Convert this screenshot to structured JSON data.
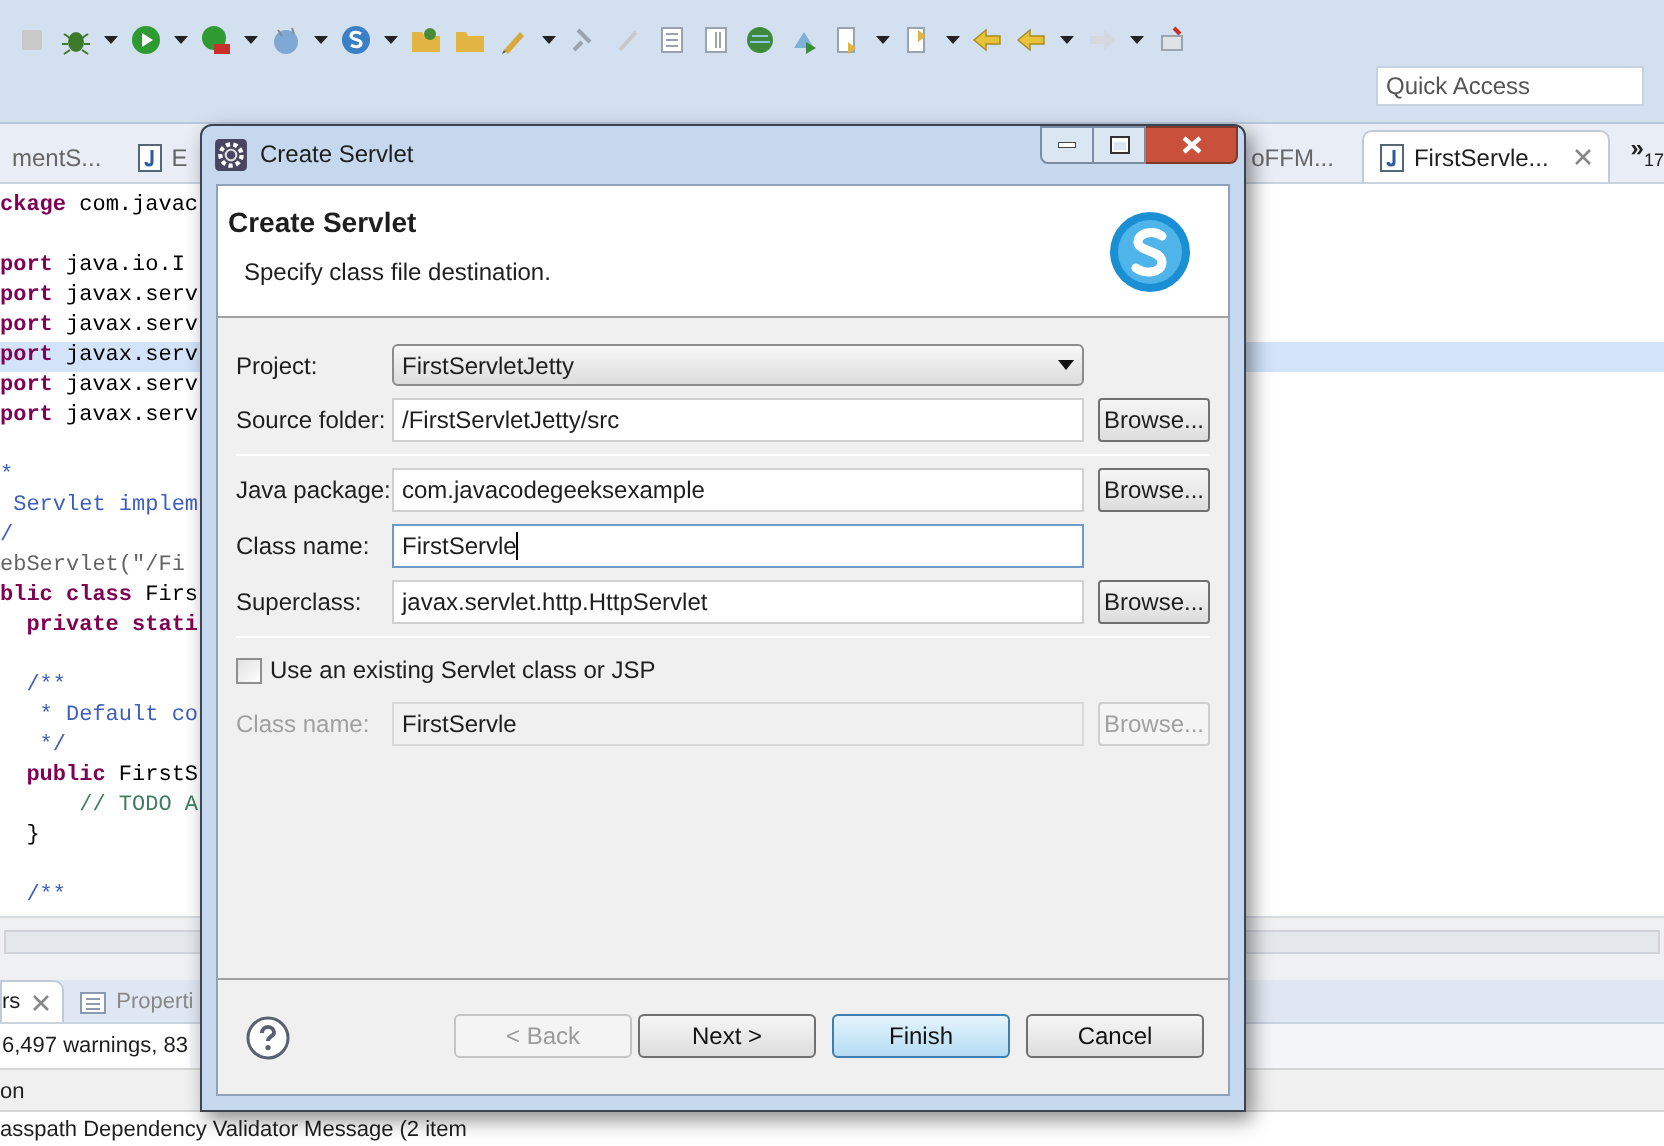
{
  "toolbar": {
    "quick_access": {
      "placeholder": "Quick Access"
    }
  },
  "editor_tabs": [
    {
      "label": "mentS...",
      "selected": false,
      "icon": false
    },
    {
      "label": "E",
      "selected": false,
      "icon": true
    },
    {
      "label": "oFFM...",
      "selected": false,
      "icon": false
    },
    {
      "label": "FirstServle...",
      "selected": true,
      "icon": true
    }
  ],
  "tab_overflow": {
    "symbol": "»",
    "count": "17"
  },
  "code_lines": [
    {
      "text": "**ckage** com.javac",
      "kind": "code",
      "highlighted": false
    },
    {
      "kind": "blank"
    },
    {
      "text": "**port** java.io.I",
      "kind": "code",
      "highlighted": false
    },
    {
      "text": "**port** javax.serv",
      "kind": "code",
      "highlighted": false
    },
    {
      "text": "**port** javax.serv",
      "kind": "code",
      "highlighted": false
    },
    {
      "text": "**port** javax.serv",
      "kind": "code",
      "highlighted": true
    },
    {
      "text": "**port** javax.serv",
      "kind": "code",
      "highlighted": false
    },
    {
      "text": "**port** javax.serv",
      "kind": "code",
      "highlighted": false
    },
    {
      "kind": "blank"
    },
    {
      "text": "*",
      "kind": "comment",
      "highlighted": false
    },
    {
      "text": " Servlet implem",
      "kind": "comment",
      "highlighted": false
    },
    {
      "text": "/",
      "kind": "comment",
      "highlighted": false
    },
    {
      "text": "ebServlet(\"/Fi",
      "kind": "annotation",
      "highlighted": false
    },
    {
      "text": "**blic class** Firs",
      "kind": "code",
      "highlighted": false
    },
    {
      "text": "  **private stati**",
      "kind": "code",
      "highlighted": false
    },
    {
      "kind": "blank"
    },
    {
      "text": "  /**",
      "kind": "comment",
      "highlighted": false
    },
    {
      "text": "   * Default co",
      "kind": "comment",
      "highlighted": false
    },
    {
      "text": "   */",
      "kind": "comment",
      "highlighted": false
    },
    {
      "text": "  **public** FirstS",
      "kind": "code",
      "highlighted": false
    },
    {
      "text": "      // TODO A",
      "kind": "todo",
      "highlighted": false
    },
    {
      "text": "  }",
      "kind": "code",
      "highlighted": false
    },
    {
      "kind": "blank"
    },
    {
      "text": "  /**",
      "kind": "comment",
      "highlighted": false
    }
  ],
  "bottom_panel": {
    "tabs": [
      {
        "label": "rs",
        "selected": true
      },
      {
        "label": "Properti",
        "selected": false
      }
    ],
    "summary": "6,497 warnings, 83",
    "column_header": "on",
    "rows": [
      "asspath Dependency Validator Message (2 item"
    ]
  },
  "dialog": {
    "title": "Create Servlet",
    "header": {
      "title": "Create Servlet",
      "description": "Specify class file destination."
    },
    "rows": [
      {
        "kind": "combo",
        "label": "Project:",
        "value": "FirstServletJetty"
      },
      {
        "kind": "field",
        "label": "Source folder:",
        "value": "/FirstServletJetty/src",
        "button": "Browse...",
        "focused": false,
        "disabled": false
      },
      {
        "kind": "separator"
      },
      {
        "kind": "field",
        "label": "Java package:",
        "value": "com.javacodegeeksexample",
        "button": "Browse...",
        "focused": false,
        "disabled": false
      },
      {
        "kind": "field",
        "label": "Class name:",
        "value": "FirstServle",
        "focused": true,
        "disabled": false
      },
      {
        "kind": "field",
        "label": "Superclass:",
        "value": "javax.servlet.http.HttpServlet",
        "button": "Browse...",
        "focused": false,
        "disabled": false
      },
      {
        "kind": "separator"
      },
      {
        "kind": "checkbox",
        "label": "Use an existing Servlet class or JSP",
        "checked": false
      },
      {
        "kind": "field",
        "label": "Class name:",
        "value": "FirstServle",
        "button": "Browse...",
        "focused": false,
        "disabled": true
      }
    ],
    "buttons": [
      {
        "label": "< Back",
        "disabled": true,
        "default": false
      },
      {
        "label": "Next >",
        "disabled": false,
        "default": false
      },
      {
        "label": "Finish",
        "disabled": false,
        "default": true
      },
      {
        "label": "Cancel",
        "disabled": false,
        "default": false
      }
    ]
  }
}
